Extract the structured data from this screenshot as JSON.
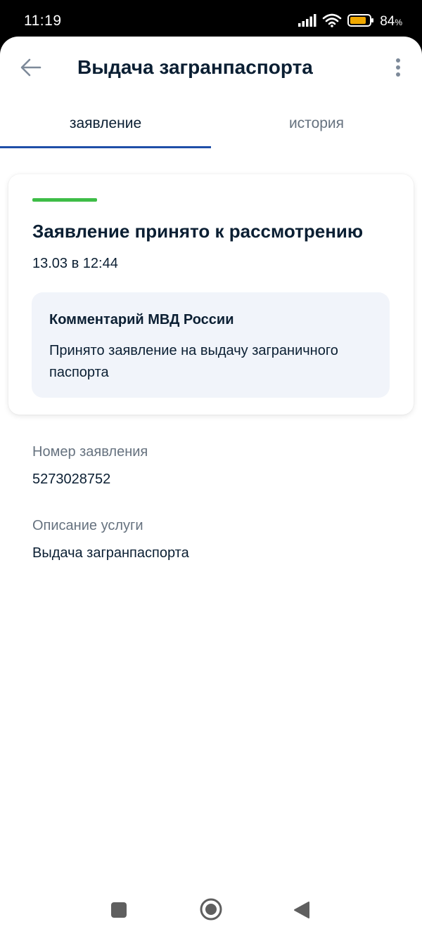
{
  "status_bar": {
    "time": "11:19",
    "battery_percent": "84",
    "battery_suffix": "%",
    "battery_level": 0.84,
    "battery_color": "#f0a800"
  },
  "header": {
    "title": "Выдача загранпаспорта"
  },
  "tabs": [
    {
      "label": "заявление",
      "active": true
    },
    {
      "label": "история",
      "active": false
    }
  ],
  "status_card": {
    "status_color": "#3ebd47",
    "title": "Заявление принято к рассмотрению",
    "date": "13.03 в 12:44",
    "comment": {
      "title": "Комментарий МВД России",
      "text": "Принято заявление на выдачу заграничного паспорта"
    }
  },
  "details": [
    {
      "label": "Номер заявления",
      "value": "5273028752"
    },
    {
      "label": "Описание услуги",
      "value": "Выдача загранпаспорта"
    }
  ],
  "icons": {
    "back": "arrow-left-icon",
    "menu": "more-vertical-icon",
    "nav_recents": "square-icon",
    "nav_home": "circle-icon",
    "nav_back": "triangle-back-icon"
  }
}
